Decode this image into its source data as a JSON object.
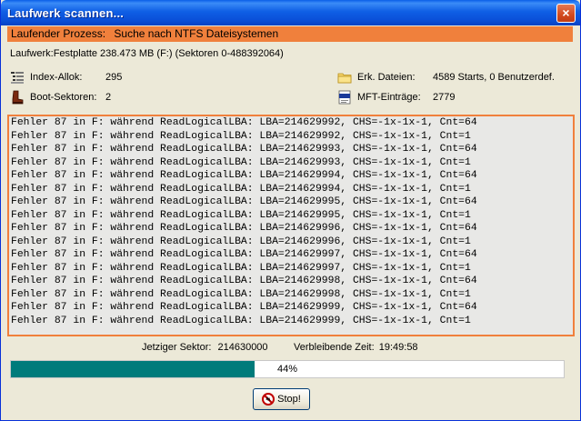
{
  "window": {
    "title": "Laufwerk scannen...",
    "close_symbol": "×"
  },
  "status": {
    "label": "Laufender Prozess:",
    "value": "Suche nach NTFS Dateisystemen",
    "color": "#f0803c"
  },
  "drive": {
    "text": "Laufwerk:Festplatte 238.473 MB (F:) (Sektoren 0-488392064)"
  },
  "info": {
    "index_alloc": {
      "label": "Index-Allok:",
      "value": "295",
      "icon": "index-icon"
    },
    "boot_sectors": {
      "label": "Boot-Sektoren:",
      "value": "2",
      "icon": "boot-icon"
    },
    "found_files": {
      "label": "Erk. Dateien:",
      "value": "4589 Starts, 0 Benutzerdef.",
      "icon": "folder-icon"
    },
    "mft_entries": {
      "label": "MFT-Einträge:",
      "value": "2779",
      "icon": "file-icon"
    }
  },
  "log": [
    "Fehler 87 in F: während ReadLogicalLBA: LBA=214629992, CHS=-1x-1x-1, Cnt=64",
    "Fehler 87 in F: während ReadLogicalLBA: LBA=214629992, CHS=-1x-1x-1, Cnt=1",
    "Fehler 87 in F: während ReadLogicalLBA: LBA=214629993, CHS=-1x-1x-1, Cnt=64",
    "Fehler 87 in F: während ReadLogicalLBA: LBA=214629993, CHS=-1x-1x-1, Cnt=1",
    "Fehler 87 in F: während ReadLogicalLBA: LBA=214629994, CHS=-1x-1x-1, Cnt=64",
    "Fehler 87 in F: während ReadLogicalLBA: LBA=214629994, CHS=-1x-1x-1, Cnt=1",
    "Fehler 87 in F: während ReadLogicalLBA: LBA=214629995, CHS=-1x-1x-1, Cnt=64",
    "Fehler 87 in F: während ReadLogicalLBA: LBA=214629995, CHS=-1x-1x-1, Cnt=1",
    "Fehler 87 in F: während ReadLogicalLBA: LBA=214629996, CHS=-1x-1x-1, Cnt=64",
    "Fehler 87 in F: während ReadLogicalLBA: LBA=214629996, CHS=-1x-1x-1, Cnt=1",
    "Fehler 87 in F: während ReadLogicalLBA: LBA=214629997, CHS=-1x-1x-1, Cnt=64",
    "Fehler 87 in F: während ReadLogicalLBA: LBA=214629997, CHS=-1x-1x-1, Cnt=1",
    "Fehler 87 in F: während ReadLogicalLBA: LBA=214629998, CHS=-1x-1x-1, Cnt=64",
    "Fehler 87 in F: während ReadLogicalLBA: LBA=214629998, CHS=-1x-1x-1, Cnt=1",
    "Fehler 87 in F: während ReadLogicalLBA: LBA=214629999, CHS=-1x-1x-1, Cnt=64",
    "Fehler 87 in F: während ReadLogicalLBA: LBA=214629999, CHS=-1x-1x-1, Cnt=1"
  ],
  "sector": {
    "label": "Jetziger Sektor:",
    "value": "214630000"
  },
  "remaining": {
    "label": "Verbleibende Zeit:",
    "value": "19:49:58"
  },
  "progress": {
    "percent": 44,
    "text": "44%",
    "color": "#007b7b"
  },
  "stop_button": {
    "label": "Stop!",
    "icon": "stop-icon"
  }
}
